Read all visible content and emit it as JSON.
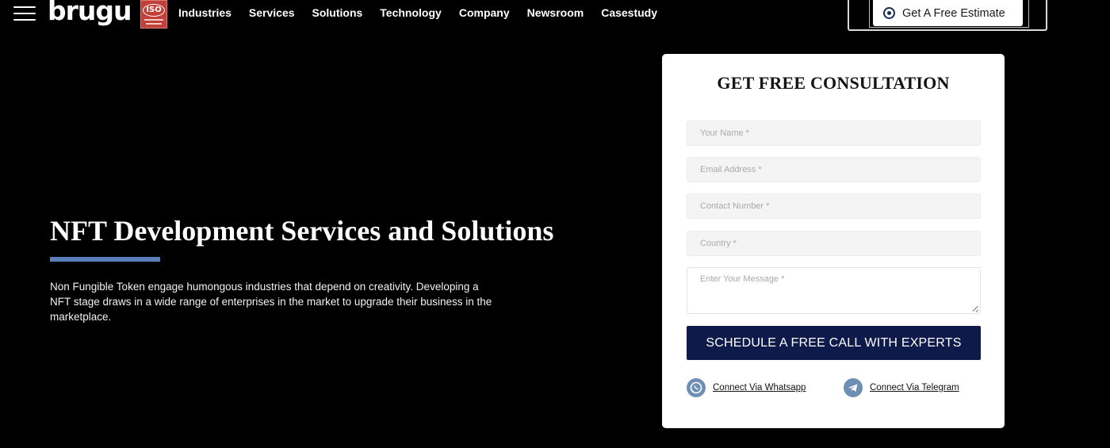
{
  "header": {
    "logo": "brugu",
    "logo_mark": "®",
    "iso_badge": "ISO",
    "nav": [
      {
        "label": "Industries"
      },
      {
        "label": "Services"
      },
      {
        "label": "Solutions"
      },
      {
        "label": "Technology"
      },
      {
        "label": "Company"
      },
      {
        "label": "Newsroom"
      },
      {
        "label": "Casestudy"
      }
    ],
    "cta_label": "Get A Free Estimate",
    "icons": {
      "menu": "hamburger-menu-icon",
      "cta": "target-circle-icon"
    }
  },
  "hero": {
    "title": "NFT Development Services and Solutions",
    "description": "Non Fungible Token engage humongous industries that depend on creativity. Developing a NFT stage draws in a wide range of enterprises in the market to upgrade their business in the marketplace.",
    "underline_color": "#5b7fbb"
  },
  "form": {
    "title": "GET FREE CONSULTATION",
    "fields": {
      "name": {
        "placeholder": "Your Name *",
        "value": ""
      },
      "email": {
        "placeholder": "Email Address *",
        "value": ""
      },
      "phone": {
        "placeholder": "Contact Number *",
        "value": ""
      },
      "country": {
        "placeholder": "Country *",
        "value": ""
      },
      "message": {
        "placeholder": "Enter Your Message *",
        "value": ""
      }
    },
    "submit_label": "SCHEDULE A FREE CALL WITH EXPERTS",
    "whatsapp_label": "Connect Via Whatsapp",
    "telegram_label": "Connect Via Telegram",
    "colors": {
      "button": "#0d1a4a",
      "connect_icon": "#6e8eb3"
    }
  }
}
